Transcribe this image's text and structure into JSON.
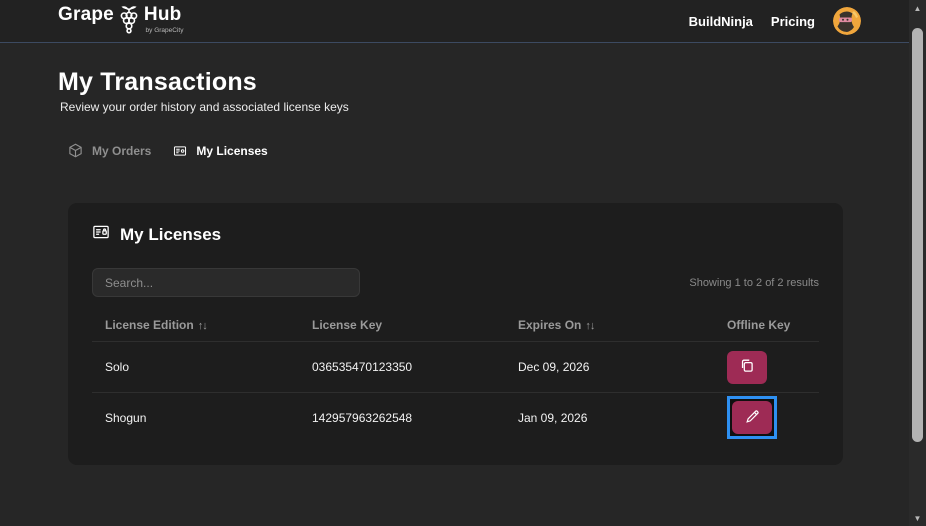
{
  "header": {
    "logo": {
      "text_grape": "Grape",
      "text_hub": "Hub",
      "byline": "by GrapeCity"
    },
    "nav_links": [
      {
        "label": "BuildNinja"
      },
      {
        "label": "Pricing"
      }
    ],
    "avatar_icon": "ninja-avatar"
  },
  "page": {
    "title": "My Transactions",
    "subtitle": "Review your order history and associated license keys"
  },
  "tabs": [
    {
      "label": "My Orders",
      "icon": "package-icon",
      "active": false
    },
    {
      "label": "My Licenses",
      "icon": "id-card-icon",
      "active": true
    }
  ],
  "card": {
    "title": "My Licenses",
    "icon": "id-card-icon",
    "search_placeholder": "Search...",
    "results_text": "Showing 1 to 2 of 2 results",
    "table": {
      "columns": [
        {
          "label": "License Edition",
          "sort_icon": "↑↓"
        },
        {
          "label": "License Key",
          "sort_icon": ""
        },
        {
          "label": "Expires On",
          "sort_icon": "↑↓"
        },
        {
          "label": "Offline Key",
          "sort_icon": ""
        }
      ],
      "rows": [
        {
          "edition": "Solo",
          "license_key": "036535470123350",
          "expires_on": "Dec 09, 2026",
          "action_icon": "copy-icon"
        },
        {
          "edition": "Shogun",
          "license_key": "142957963262548",
          "expires_on": "Jan 09, 2026",
          "action_icon": "pencil-icon",
          "highlighted": true
        }
      ]
    }
  },
  "colors": {
    "action_button": "#9e2b55",
    "highlight_border": "#2e90f2",
    "card_bg": "#1d1d1d",
    "page_bg": "#262626",
    "header_border": "#3c4a61",
    "avatar_yellow": "#f0a63c"
  }
}
